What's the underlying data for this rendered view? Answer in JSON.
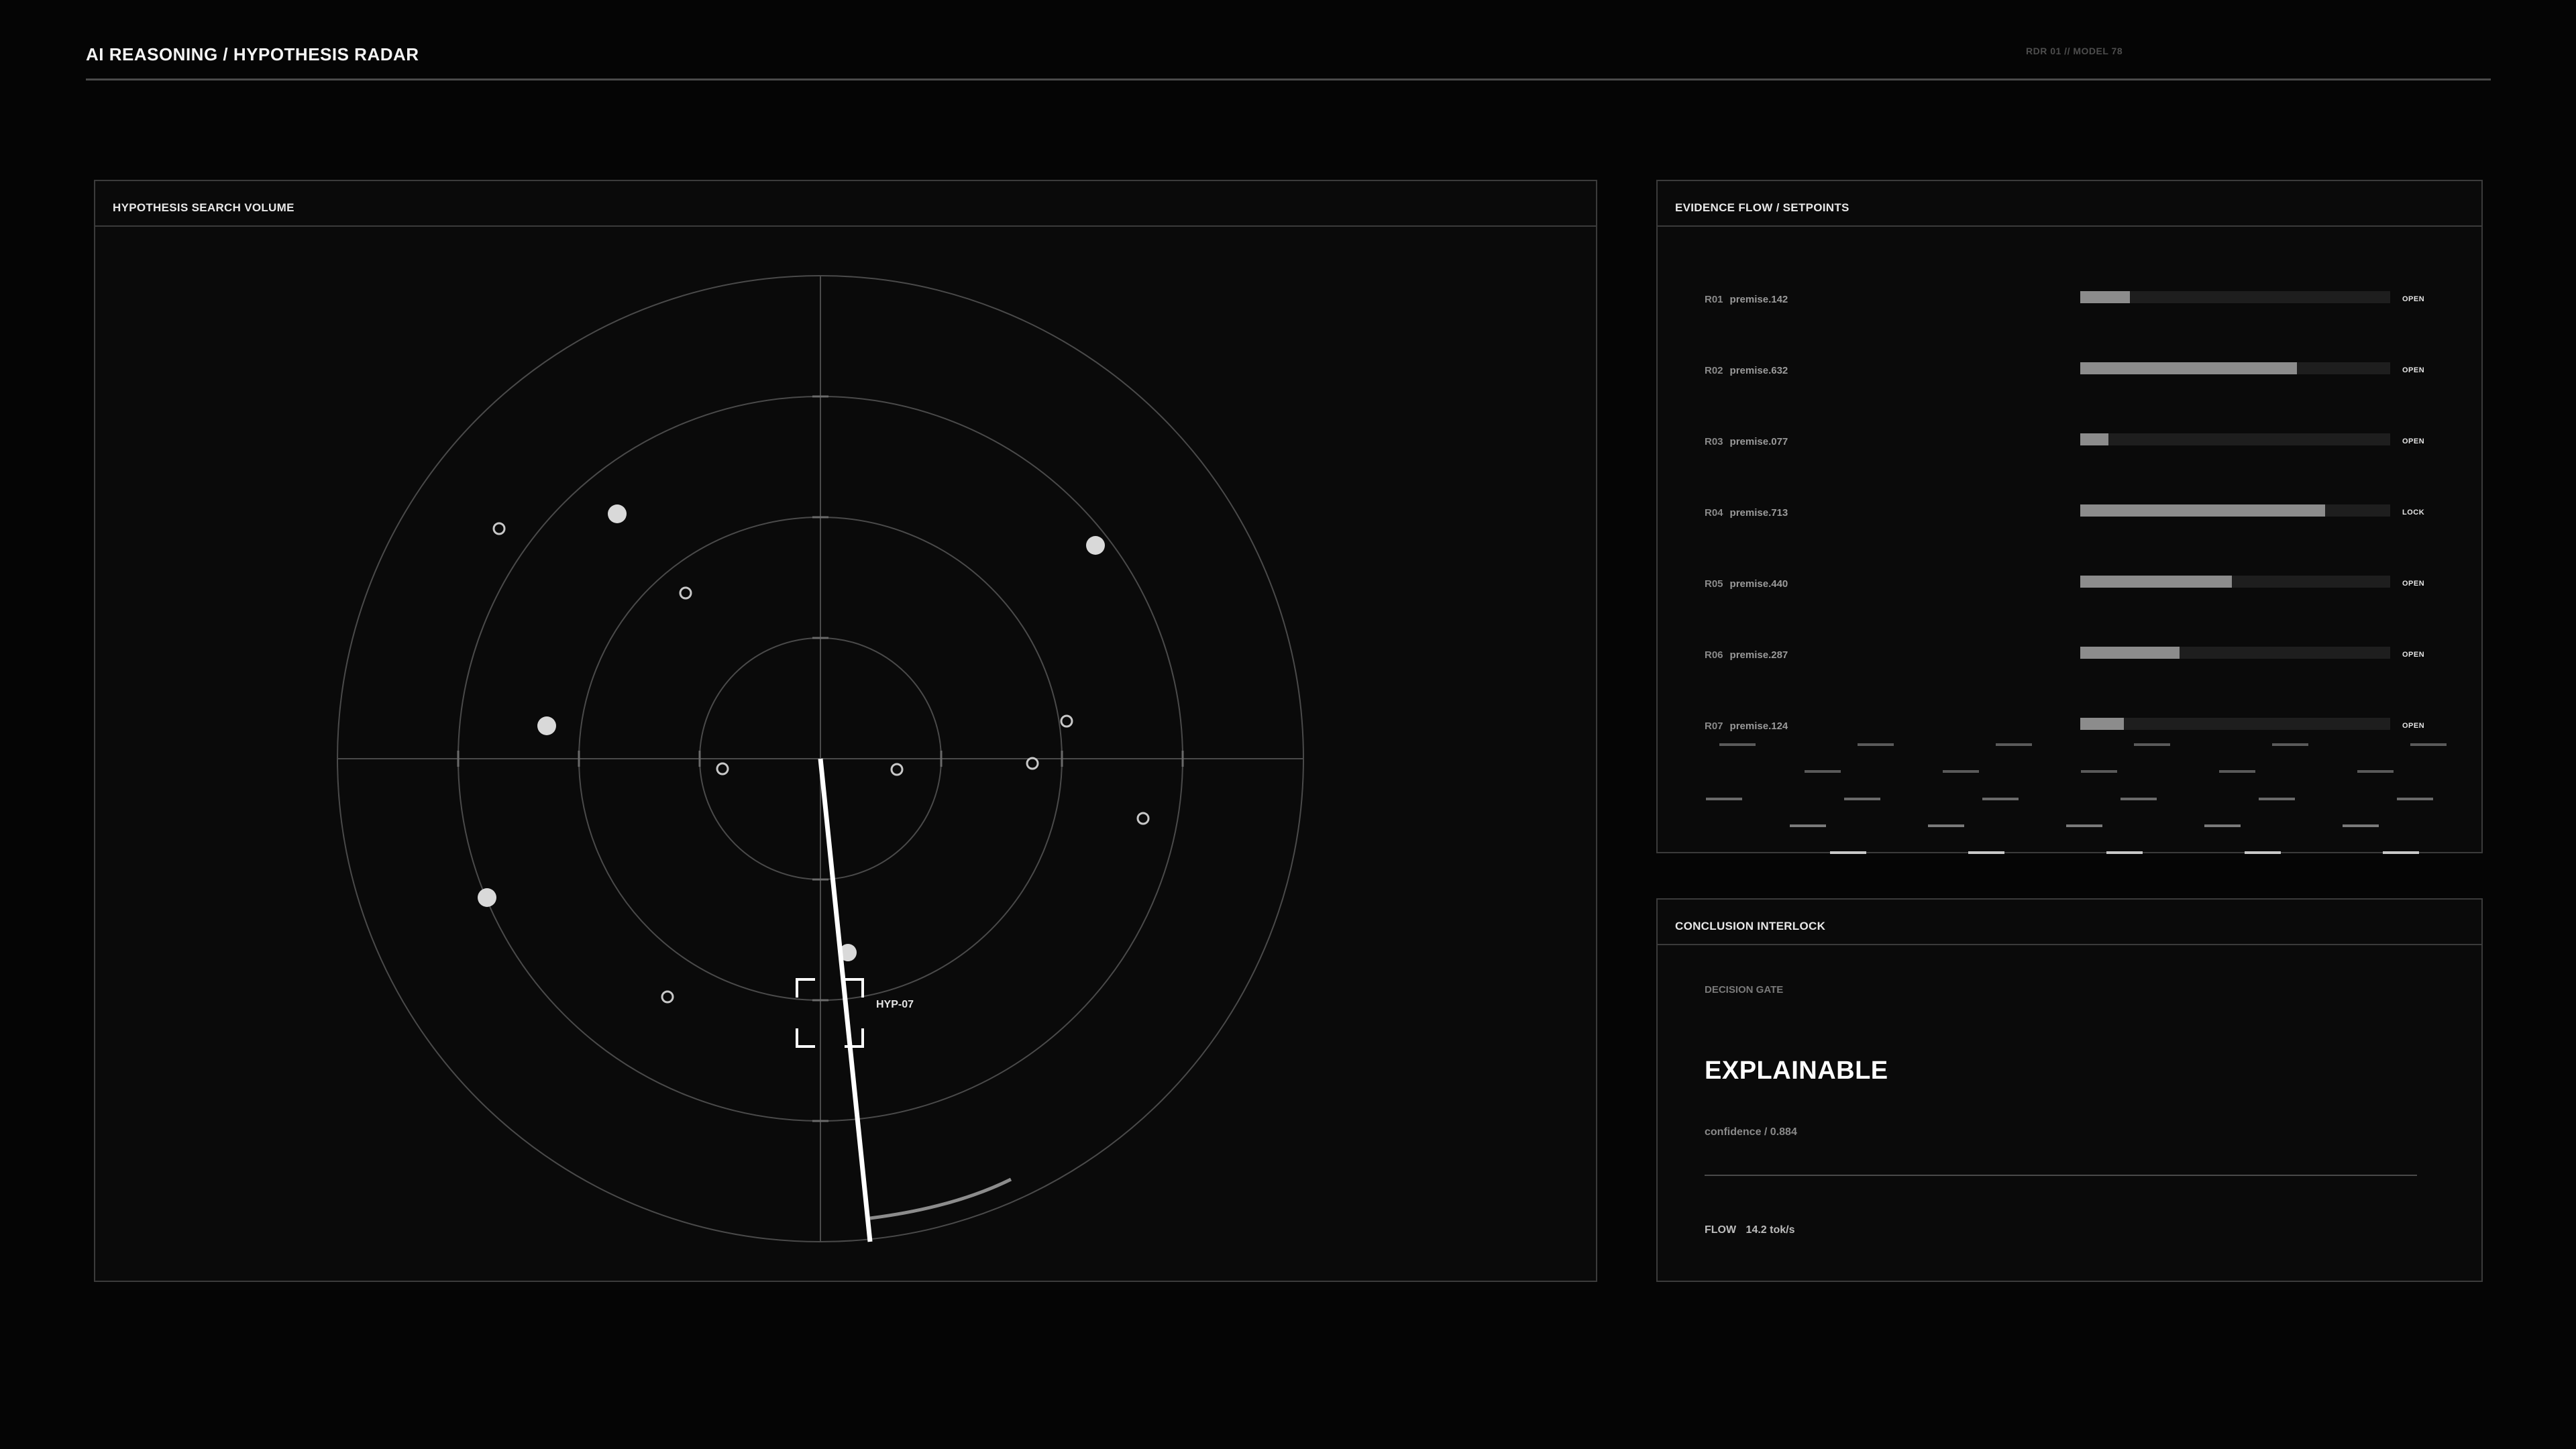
{
  "header": {
    "title": "AI REASONING / HYPOTHESIS RADAR",
    "device_id": "RDR 01 // MODEL 78"
  },
  "radar": {
    "title": "HYPOTHESIS SEARCH VOLUME",
    "target_label": "HYP-07"
  },
  "evidence": {
    "title": "EVIDENCE FLOW / SETPOINTS",
    "rows": [
      {
        "id": "R01",
        "name": "premise.142",
        "level": 0.16,
        "status": "OPEN"
      },
      {
        "id": "R02",
        "name": "premise.632",
        "level": 0.7,
        "status": "OPEN"
      },
      {
        "id": "R03",
        "name": "premise.077",
        "level": 0.09,
        "status": "OPEN"
      },
      {
        "id": "R04",
        "name": "premise.713",
        "level": 0.79,
        "status": "LOCK"
      },
      {
        "id": "R05",
        "name": "premise.440",
        "level": 0.49,
        "status": "OPEN"
      },
      {
        "id": "R06",
        "name": "premise.287",
        "level": 0.32,
        "status": "OPEN"
      },
      {
        "id": "R07",
        "name": "premise.124",
        "level": 0.14,
        "status": "OPEN"
      }
    ]
  },
  "conclusion": {
    "title": "CONCLUSION INTERLOCK",
    "gate_label": "DECISION GATE",
    "gate_value": "EXPLAINABLE",
    "confidence": "confidence / 0.884",
    "flow_label": "FLOW",
    "flow_value": "14.2 tok/s"
  },
  "colors": {
    "background": "#050505",
    "panel": "#0a0a0a",
    "border": "#3b3b3b",
    "accent": "#ffffff",
    "bar_fill": "#8c8c8c"
  }
}
